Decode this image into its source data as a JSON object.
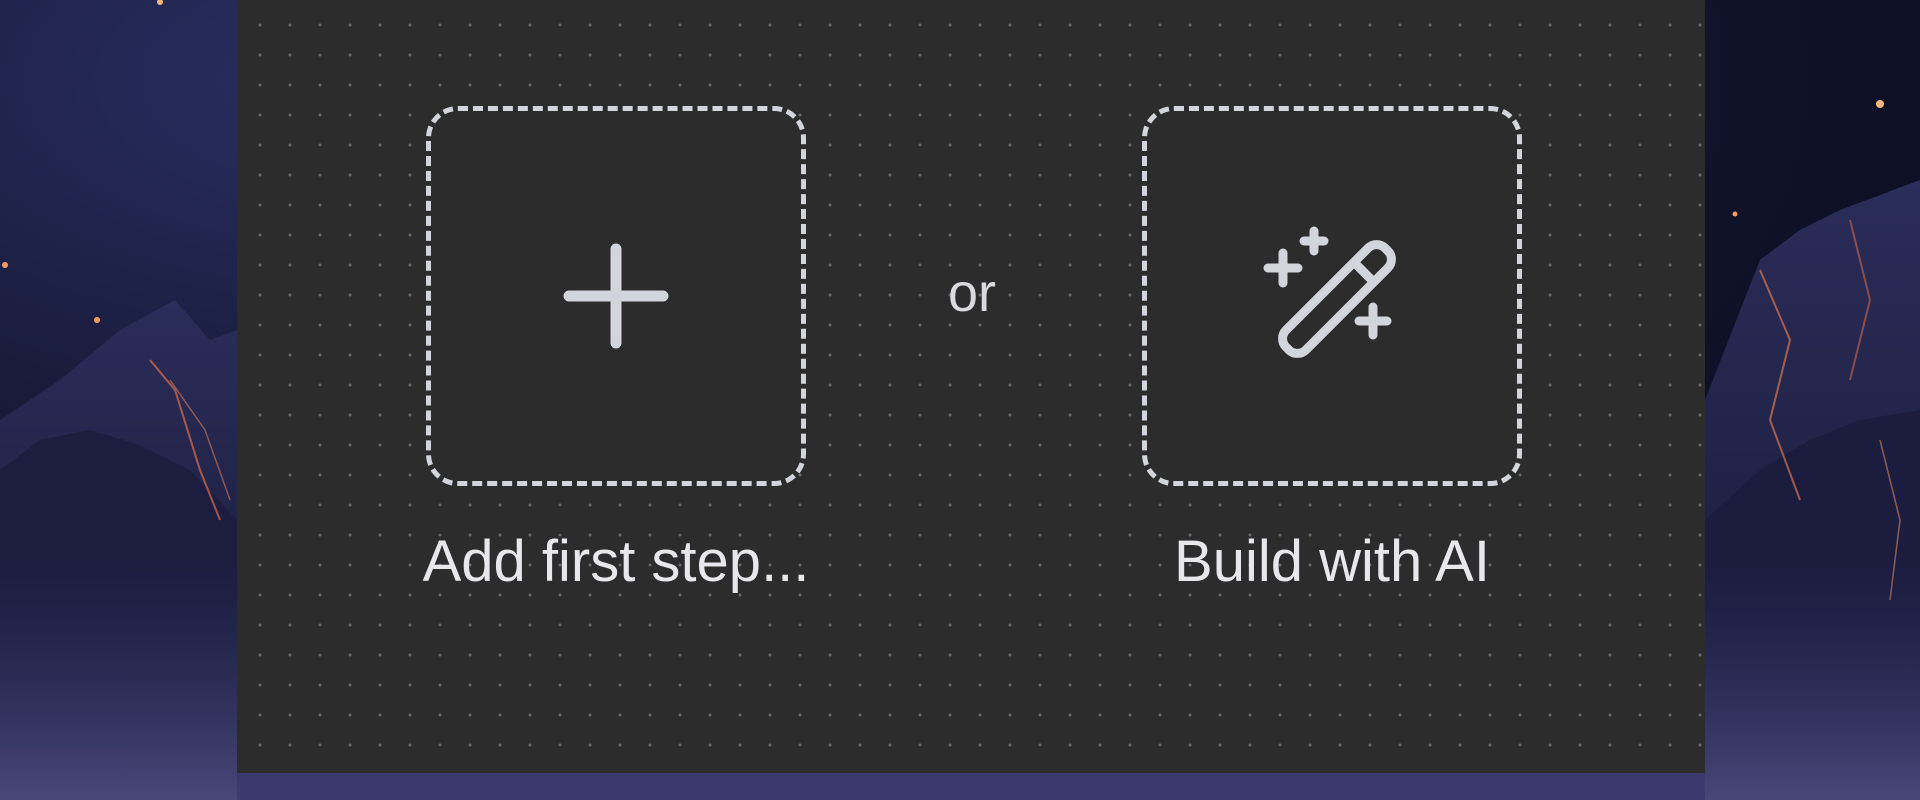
{
  "canvas": {
    "add_step": {
      "label": "Add first step...",
      "icon": "plus-icon"
    },
    "separator": "or",
    "build_ai": {
      "label": "Build with AI",
      "icon": "magic-wand-icon"
    }
  },
  "colors": {
    "canvas_bg": "#2c2c2c",
    "dash_border": "#d3d5dc",
    "label_text": "#e8e8ec",
    "background_sky": "#181b3a"
  }
}
